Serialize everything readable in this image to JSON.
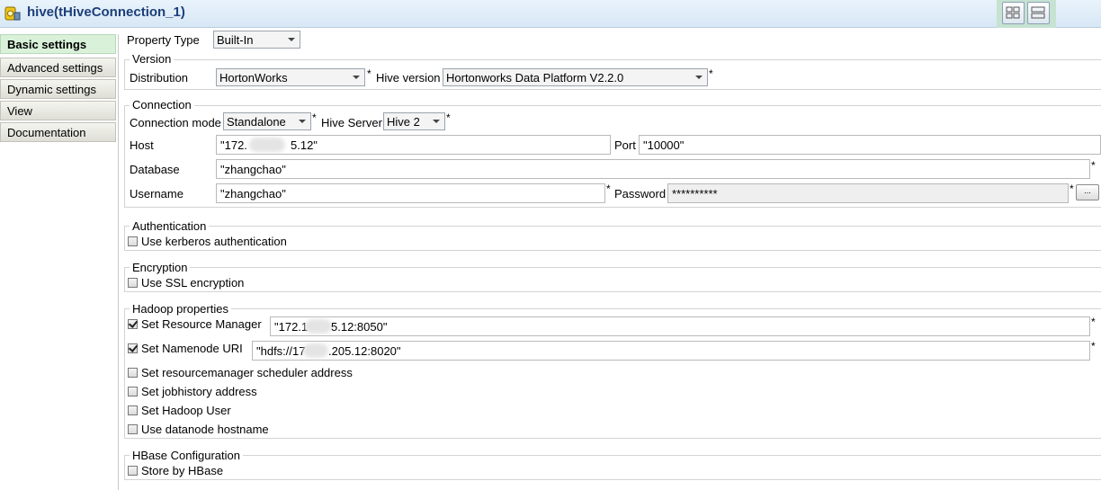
{
  "window": {
    "title": "hive(tHiveConnection_1)"
  },
  "sidebar": {
    "items": [
      {
        "label": "Basic settings"
      },
      {
        "label": "Advanced settings"
      },
      {
        "label": "Dynamic settings"
      },
      {
        "label": "View"
      },
      {
        "label": "Documentation"
      }
    ]
  },
  "property_type": {
    "label": "Property Type",
    "value": "Built-In"
  },
  "version": {
    "title": "Version",
    "distribution_label": "Distribution",
    "distribution_value": "HortonWorks",
    "hive_version_label": "Hive version",
    "hive_version_value": "Hortonworks Data Platform V2.2.0"
  },
  "connection": {
    "title": "Connection",
    "mode_label": "Connection mode",
    "mode_value": "Standalone",
    "server_label": "Hive Server",
    "server_value": "Hive 2",
    "host_label": "Host",
    "host_value_a": "\"172.",
    "host_value_b": "5.12\"",
    "port_label": "Port",
    "port_value": "\"10000\"",
    "database_label": "Database",
    "database_value": "\"zhangchao\"",
    "username_label": "Username",
    "username_value": "\"zhangchao\"",
    "password_label": "Password",
    "password_value": "**********",
    "password_button": "..."
  },
  "authentication": {
    "title": "Authentication",
    "kerberos_label": "Use kerberos authentication"
  },
  "encryption": {
    "title": "Encryption",
    "ssl_label": "Use SSL encryption"
  },
  "hadoop": {
    "title": "Hadoop properties",
    "resource_manager_label": "Set Resource Manager",
    "resource_manager_value_a": "\"172.1",
    "resource_manager_value_b": "5.12:8050\"",
    "namenode_label": "Set Namenode URI",
    "namenode_value_a": "\"hdfs://17",
    "namenode_value_b": ".205.12:8020\"",
    "scheduler_label": "Set resourcemanager scheduler address",
    "jobhistory_label": "Set jobhistory address",
    "hadoop_user_label": "Set Hadoop User",
    "datanode_label": "Use datanode hostname"
  },
  "hbase": {
    "title": "HBase Configuration",
    "store_label": "Store by HBase"
  },
  "required_mark": "*",
  "colors": {
    "title": "#1d3f7a",
    "active_tab": "#d9f1d9",
    "titlebar": "#d7e7f5"
  }
}
